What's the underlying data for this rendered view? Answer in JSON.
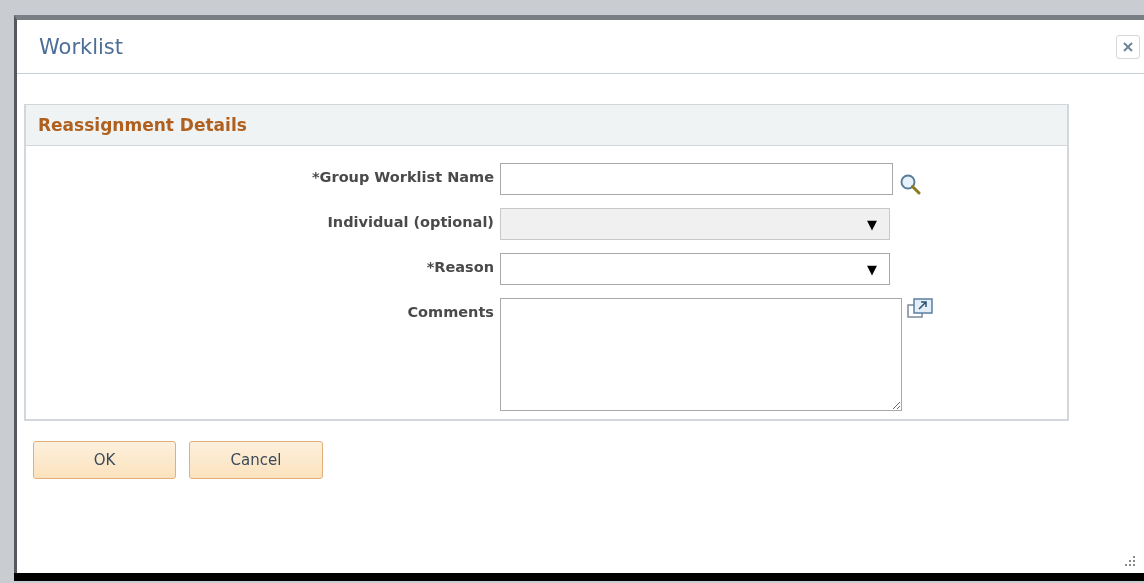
{
  "window": {
    "title": "Worklist"
  },
  "section": {
    "title": "Reassignment Details"
  },
  "fields": [
    {
      "kind": "lookup",
      "label": "*Group Worklist Name",
      "disabled": false
    },
    {
      "kind": "select",
      "label": "Individual (optional)",
      "disabled": true,
      "arrow": "▼"
    },
    {
      "kind": "select",
      "label": "*Reason",
      "disabled": false,
      "arrow": "▼"
    },
    {
      "kind": "textarea",
      "label": "Comments",
      "disabled": false
    }
  ],
  "buttons": [
    "OK",
    "Cancel"
  ]
}
